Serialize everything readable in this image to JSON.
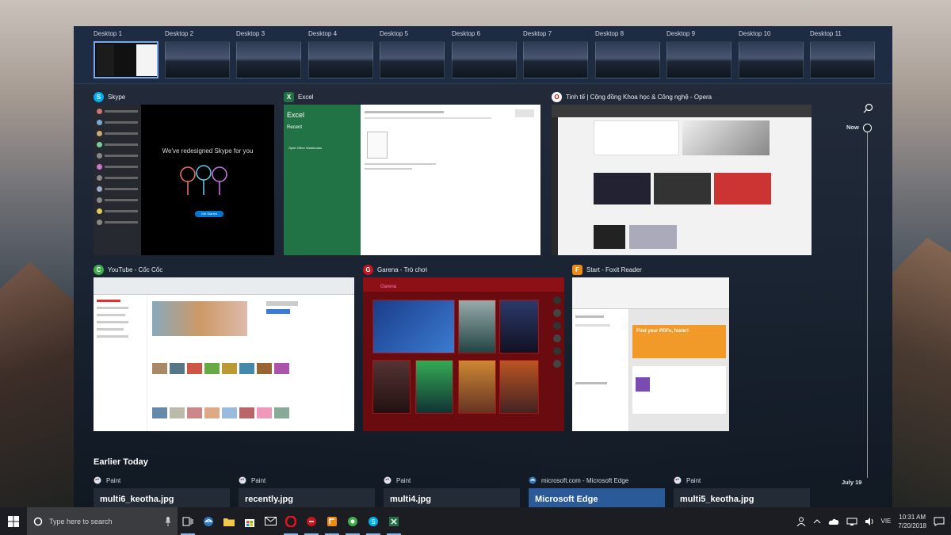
{
  "desktops": [
    {
      "label": "Desktop 1",
      "active": true
    },
    {
      "label": "Desktop 2"
    },
    {
      "label": "Desktop 3"
    },
    {
      "label": "Desktop 4"
    },
    {
      "label": "Desktop 5"
    },
    {
      "label": "Desktop 6"
    },
    {
      "label": "Desktop 7"
    },
    {
      "label": "Desktop 8"
    },
    {
      "label": "Desktop 9"
    },
    {
      "label": "Desktop 10"
    },
    {
      "label": "Desktop 11"
    }
  ],
  "windows": {
    "skype": {
      "title": "Skype",
      "banner": "We've redesigned Skype for you",
      "button": "Get Started"
    },
    "excel": {
      "title": "Excel",
      "app_name": "Excel",
      "recent": "Recent",
      "open_other": "Open Other Workbooks"
    },
    "opera": {
      "title": "Tinh tế | Cộng đồng Khoa học & Công nghệ - Opera"
    },
    "coccoc": {
      "title": "YouTube - Cốc Cốc"
    },
    "garena": {
      "title": "Garena - Trò chơi",
      "brand": "Garena"
    },
    "foxit": {
      "title": "Start - Foxit Reader",
      "promo": "Find your PDFs, faster!"
    }
  },
  "earlier": {
    "heading": "Earlier Today",
    "items": [
      {
        "app": "Paint",
        "file": "multi6_keotha.jpg"
      },
      {
        "app": "Paint",
        "file": "recently.jpg"
      },
      {
        "app": "Paint",
        "file": "multi4.jpg"
      },
      {
        "app": "microsoft.com - Microsoft Edge",
        "file": "Microsoft Edge"
      },
      {
        "app": "Paint",
        "file": "multi5_keotha.jpg"
      }
    ]
  },
  "timeline": {
    "now": "Now",
    "date": "July 19"
  },
  "taskbar": {
    "search_placeholder": "Type here to search",
    "language": "VIE",
    "time": "10:31 AM",
    "date": "7/20/2018"
  },
  "colors": {
    "accent": "#7aa7e8",
    "excel_green": "#217346",
    "edge_blue": "#2a5b98",
    "garena_red": "#8c1015"
  }
}
